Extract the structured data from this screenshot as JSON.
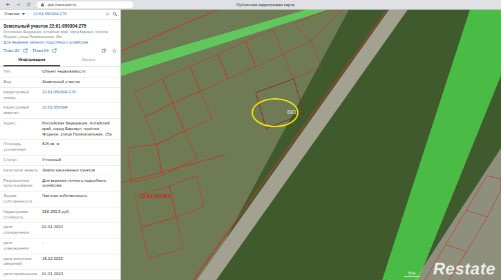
{
  "browser": {
    "address": "pkk.rosreestr.ru",
    "title": "Публичная кадастровая карта"
  },
  "search": {
    "category": "Участки",
    "query": "22:61:050304:279"
  },
  "object": {
    "title": "Земельный участок 22:61:050304:279",
    "address": "Российская Федерация, Алтайский край, город Барнаул, посёлок Ягодное, улица Привокзальная, 15а",
    "use": "Для ведения личного подсобного хозяйства",
    "links": [
      "План ЗУ",
      "План КК"
    ]
  },
  "tabs": [
    {
      "label": "Информация",
      "selected": true
    },
    {
      "label": "Услуги",
      "selected": false
    }
  ],
  "fields": [
    {
      "label": "Тип:",
      "value": "Объект недвижимости",
      "kind": "text"
    },
    {
      "label": "Вид:",
      "value": "Земельный участок",
      "kind": "text"
    },
    {
      "label": "Кадастровый номер:",
      "value": "22:61:050304:279",
      "kind": "link"
    },
    {
      "label": "Кадастровый квартал:",
      "value": "22:61:050304",
      "kind": "link"
    },
    {
      "label": "Адрес:",
      "value": "Российская Федерация, Алтайский край, город Барнаул, посёлок Ягодное, улица Привокзальная, 15а",
      "kind": "text"
    },
    {
      "label": "Площадь уточненная:",
      "value": "825 кв. м",
      "kind": "text"
    },
    {
      "label": "Статус:",
      "value": "Учтенный",
      "kind": "text"
    },
    {
      "label": "Категория земель:",
      "value": "Земли населённых пунктов",
      "kind": "text"
    },
    {
      "label": "Разрешенное использование:",
      "value": "Для ведения личного подсобного хозяйства",
      "kind": "text"
    },
    {
      "label": "Форма собственности:",
      "value": "Частная собственность",
      "kind": "text"
    },
    {
      "label": "Кадастровая стоимость:",
      "value": "256 263,5 руб.",
      "kind": "text"
    },
    {
      "label": "дата определения:",
      "value": "01.01.2022",
      "kind": "text"
    },
    {
      "label": "дата утверждения:",
      "value": "-",
      "kind": "text"
    },
    {
      "label": "дата внесения сведений:",
      "value": "18.12.2022",
      "kind": "text"
    },
    {
      "label": "дата применения:",
      "value": "01.01.2023",
      "kind": "text"
    }
  ],
  "map": {
    "selection_label": "279",
    "district_label": "22:61:050304",
    "scale": "50 м",
    "watermark": "Restate"
  }
}
